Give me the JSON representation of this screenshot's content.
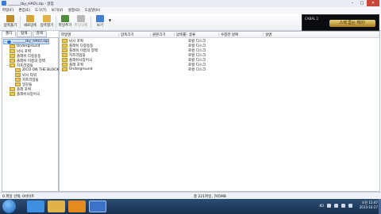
{
  "window": {
    "title": "_______(by_HAO).zip - 알집",
    "buttons": [
      "–",
      "□",
      "✕"
    ]
  },
  "menu": [
    "파일(F)",
    "편집(E)",
    "도구(T)",
    "보기(V)",
    "설정(O)",
    "도움말(H)"
  ],
  "toolbar": [
    {
      "label": "압축풀기",
      "icon": "extract-icon",
      "color": "#c08a2b",
      "disabled": false
    },
    {
      "label": "새로압축",
      "icon": "new-archive-icon",
      "color": "#d6a437",
      "disabled": false
    },
    {
      "label": "압축열기",
      "icon": "open-archive-icon",
      "color": "#e1b14a",
      "disabled": false
    },
    {
      "label": "파일추가",
      "icon": "add-file-icon",
      "color": "#4f8c3c",
      "disabled": false
    },
    {
      "label": "파일삭제",
      "icon": "delete-file-icon",
      "color": "#9a9a9a",
      "disabled": true
    },
    {
      "label": "보기",
      "icon": "view-icon",
      "color": "#3f7fd0",
      "disabled": false
    }
  ],
  "ad": {
    "brand": "CABAL 2",
    "slogan": "스펙 줍는 재미!"
  },
  "tabs": [
    "폴더",
    "탐색",
    "검색"
  ],
  "tree": [
    {
      "label": "_______(by_HAO).zip",
      "level": 0,
      "type": "archive",
      "expander": "−",
      "selected": true
    },
    {
      "label": "Underground",
      "level": 1,
      "type": "folder",
      "expander": "",
      "selected": false
    },
    {
      "label": "낚시 포획",
      "level": 1,
      "type": "folder",
      "expander": "",
      "selected": false
    },
    {
      "label": "플래쉬 다중등등",
      "level": 1,
      "type": "folder",
      "expander": "",
      "selected": false
    },
    {
      "label": "플래쉬 이름의 장벽",
      "level": 1,
      "type": "folder",
      "expander": "",
      "selected": false
    },
    {
      "label": "지프리업들",
      "level": 1,
      "type": "folder",
      "expander": "−",
      "selected": false
    },
    {
      "label": "ZICO ON THE BLOCK",
      "level": 2,
      "type": "folder",
      "expander": "",
      "selected": false
    },
    {
      "label": "낚시 타워",
      "level": 2,
      "type": "folder",
      "expander": "",
      "selected": false
    },
    {
      "label": "지프리업들",
      "level": 2,
      "type": "folder",
      "expander": "",
      "selected": false
    },
    {
      "label": "일꾼들",
      "level": 2,
      "type": "folder",
      "expander": "",
      "selected": false
    },
    {
      "label": "플래 포획",
      "level": 1,
      "type": "folder",
      "expander": "",
      "selected": false
    },
    {
      "label": "플래쉬사장어극",
      "level": 1,
      "type": "folder",
      "expander": "",
      "selected": false
    }
  ],
  "columns": [
    "파일명",
    "압축크기",
    "원본크기",
    "압축률",
    "종류",
    "수정한 날짜",
    "설명"
  ],
  "rows": [
    {
      "name": "낚시 포획",
      "type": "로컬 디스크"
    },
    {
      "name": "플래쉬 다중등등",
      "type": "로컬 디스크"
    },
    {
      "name": "플래쉬 이름의 장벽",
      "type": "로컬 디스크"
    },
    {
      "name": "지프리업들",
      "type": "로컬 디스크"
    },
    {
      "name": "플래쉬사장어극",
      "type": "로컬 디스크"
    },
    {
      "name": "플래 포획",
      "type": "로컬 디스크"
    },
    {
      "name": "Underground",
      "type": "로컬 디스크"
    }
  ],
  "status": {
    "left": "0 파일 선택, 0바이트",
    "right": "총 221파일, 705MB"
  },
  "taskbar": {
    "apps": [
      {
        "icon": "ie-icon",
        "color": "#3f8fe0"
      },
      {
        "icon": "explorer-icon",
        "color": "#e2b24a"
      },
      {
        "icon": "media-player-icon",
        "color": "#e58a1f"
      },
      {
        "icon": "alzip-icon",
        "color": "#3c72c8"
      }
    ],
    "lang": "KO",
    "time": "오전 12:47",
    "date": "2013-10-27"
  }
}
